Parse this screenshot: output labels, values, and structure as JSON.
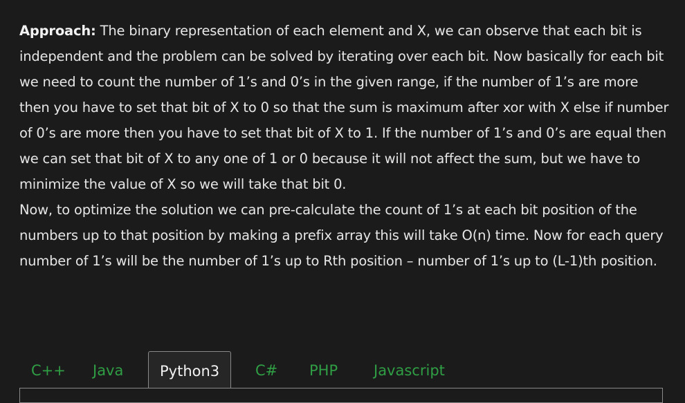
{
  "article": {
    "approach_label": "Approach:",
    "paragraph1": " The binary representation of each element and X, we can observe that each bit is independent and the problem can be solved by iterating over each bit. Now basically for each bit we need to count the number of 1’s and 0’s in the given range, if the number of 1’s are more then you have to set that bit of X to 0 so that the sum is maximum after xor with X else if number of 0’s are more then you have to set that bit of X to 1. If the number of 1’s and 0’s are equal then we can set that bit of X to any one of 1 or 0 because it will not affect the sum, but we have to minimize the value of X so we will take that bit 0.",
    "paragraph2": "Now, to optimize the solution we can pre-calculate the count of 1’s at each bit position of the numbers up to that position by making a prefix array this will take O(n) time. Now for each query number of 1’s will be the number of 1’s up to Rth position – number of 1’s up to (L-1)th position."
  },
  "tabs": [
    {
      "label": "C++"
    },
    {
      "label": "Java"
    },
    {
      "label": "Python3"
    },
    {
      "label": "C#"
    },
    {
      "label": "PHP"
    },
    {
      "label": "Javascript"
    }
  ],
  "active_tab": "Python3",
  "colors": {
    "background": "#1b1b1b",
    "text": "#e6e6e6",
    "tab_accent": "#2f9e44",
    "active_tab_bg": "#262626",
    "border": "#8a8a8a"
  }
}
